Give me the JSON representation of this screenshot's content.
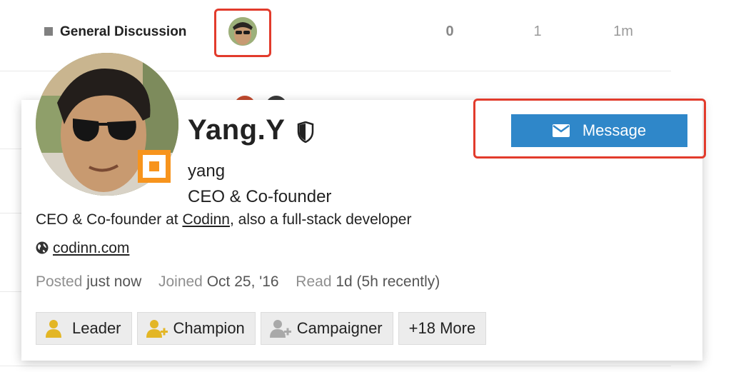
{
  "topic_row": {
    "category": "General Discussion",
    "replies": "0",
    "views": "1",
    "activity": "1m"
  },
  "user_card": {
    "name": "Yang.Y",
    "username": "yang",
    "title": "CEO & Co-founder",
    "bio_before": "CEO & Co-founder at ",
    "bio_link": "Codinn",
    "bio_after": ", also a full-stack developer",
    "website": "codinn.com",
    "posted_label": "Posted",
    "posted_value": "just now",
    "joined_label": "Joined",
    "joined_value": "Oct 25, '16",
    "read_label": "Read",
    "read_value": "1d (5h recently)",
    "message_label": "Message",
    "badges": [
      {
        "label": "Leader",
        "icon": "user-icon",
        "color": "#e3b625"
      },
      {
        "label": "Champion",
        "icon": "user-plus-icon",
        "color": "#e3b625"
      },
      {
        "label": "Campaigner",
        "icon": "user-plus-icon",
        "color": "#a9a9a9"
      },
      {
        "label": "+18 More",
        "icon": "",
        "color": ""
      }
    ]
  },
  "colors": {
    "accent": "#2f87c9",
    "flair": "#f7941d",
    "highlight": "#e23b2c"
  }
}
